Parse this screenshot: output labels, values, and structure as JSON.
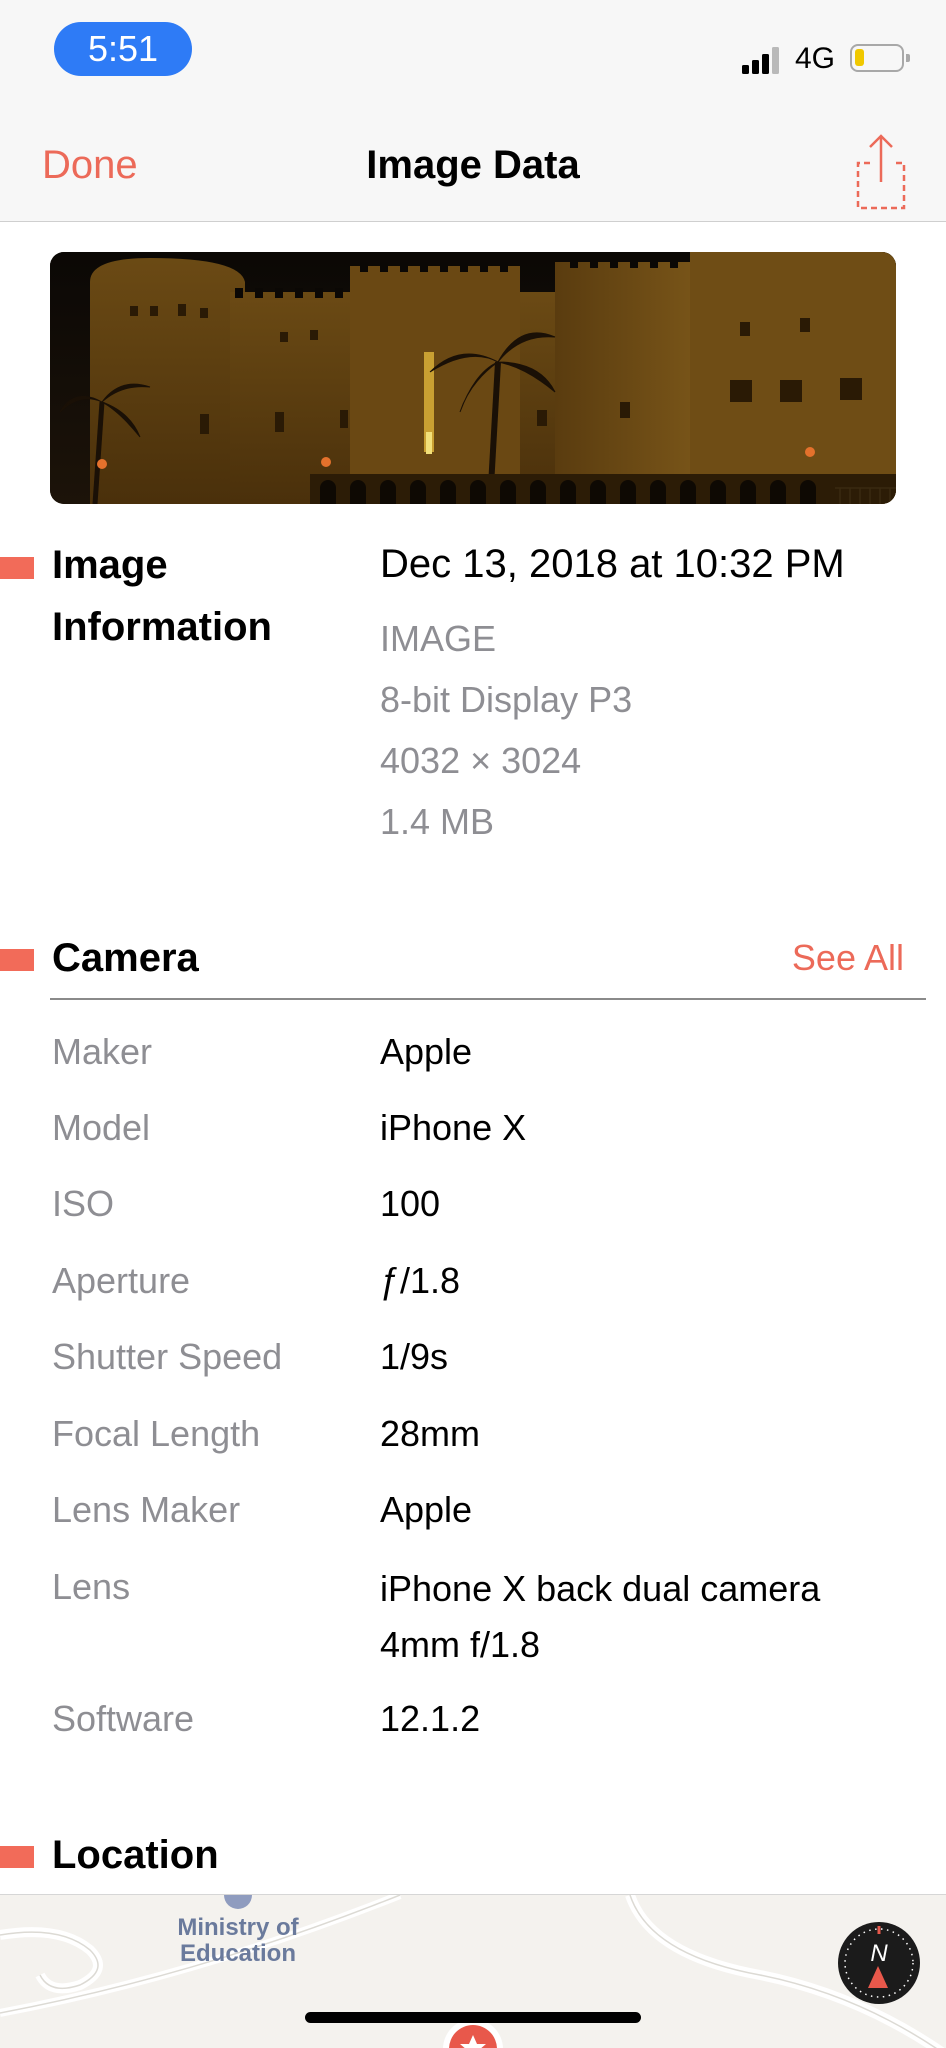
{
  "status_bar": {
    "time": "5:51",
    "network": "4G"
  },
  "nav": {
    "done_label": "Done",
    "title": "Image Data"
  },
  "image_info": {
    "title_line1": "Image",
    "title_line2": "Information",
    "date": "Dec 13, 2018 at 10:32 PM",
    "type": "IMAGE",
    "color_profile": "8-bit Display P3",
    "dimensions": "4032 × 3024",
    "file_size": "1.4 MB"
  },
  "camera": {
    "title": "Camera",
    "see_all_label": "See All",
    "rows": [
      {
        "label": "Maker",
        "value": "Apple"
      },
      {
        "label": "Model",
        "value": "iPhone X"
      },
      {
        "label": "ISO",
        "value": "100"
      },
      {
        "label": "Aperture",
        "value": "ƒ/1.8"
      },
      {
        "label": "Shutter Speed",
        "value": "1/9s"
      },
      {
        "label": "Focal Length",
        "value": "28mm"
      },
      {
        "label": "Lens Maker",
        "value": "Apple"
      },
      {
        "label": "Lens",
        "value": "iPhone X back dual camera 4mm f/1.8"
      },
      {
        "label": "Software",
        "value": "12.1.2"
      }
    ]
  },
  "location": {
    "title": "Location",
    "map_label_line1": "Ministry of",
    "map_label_line2": "Education",
    "compass_label": "N"
  },
  "colors": {
    "accent": "#ec6a59",
    "section_marker": "#f26b59",
    "secondary_text": "#8e8e93",
    "time_pill": "#2e7bf6"
  },
  "icons": {
    "share": "share-icon",
    "compass": "compass-icon",
    "signal": "cellular-signal-icon",
    "battery": "battery-icon"
  }
}
